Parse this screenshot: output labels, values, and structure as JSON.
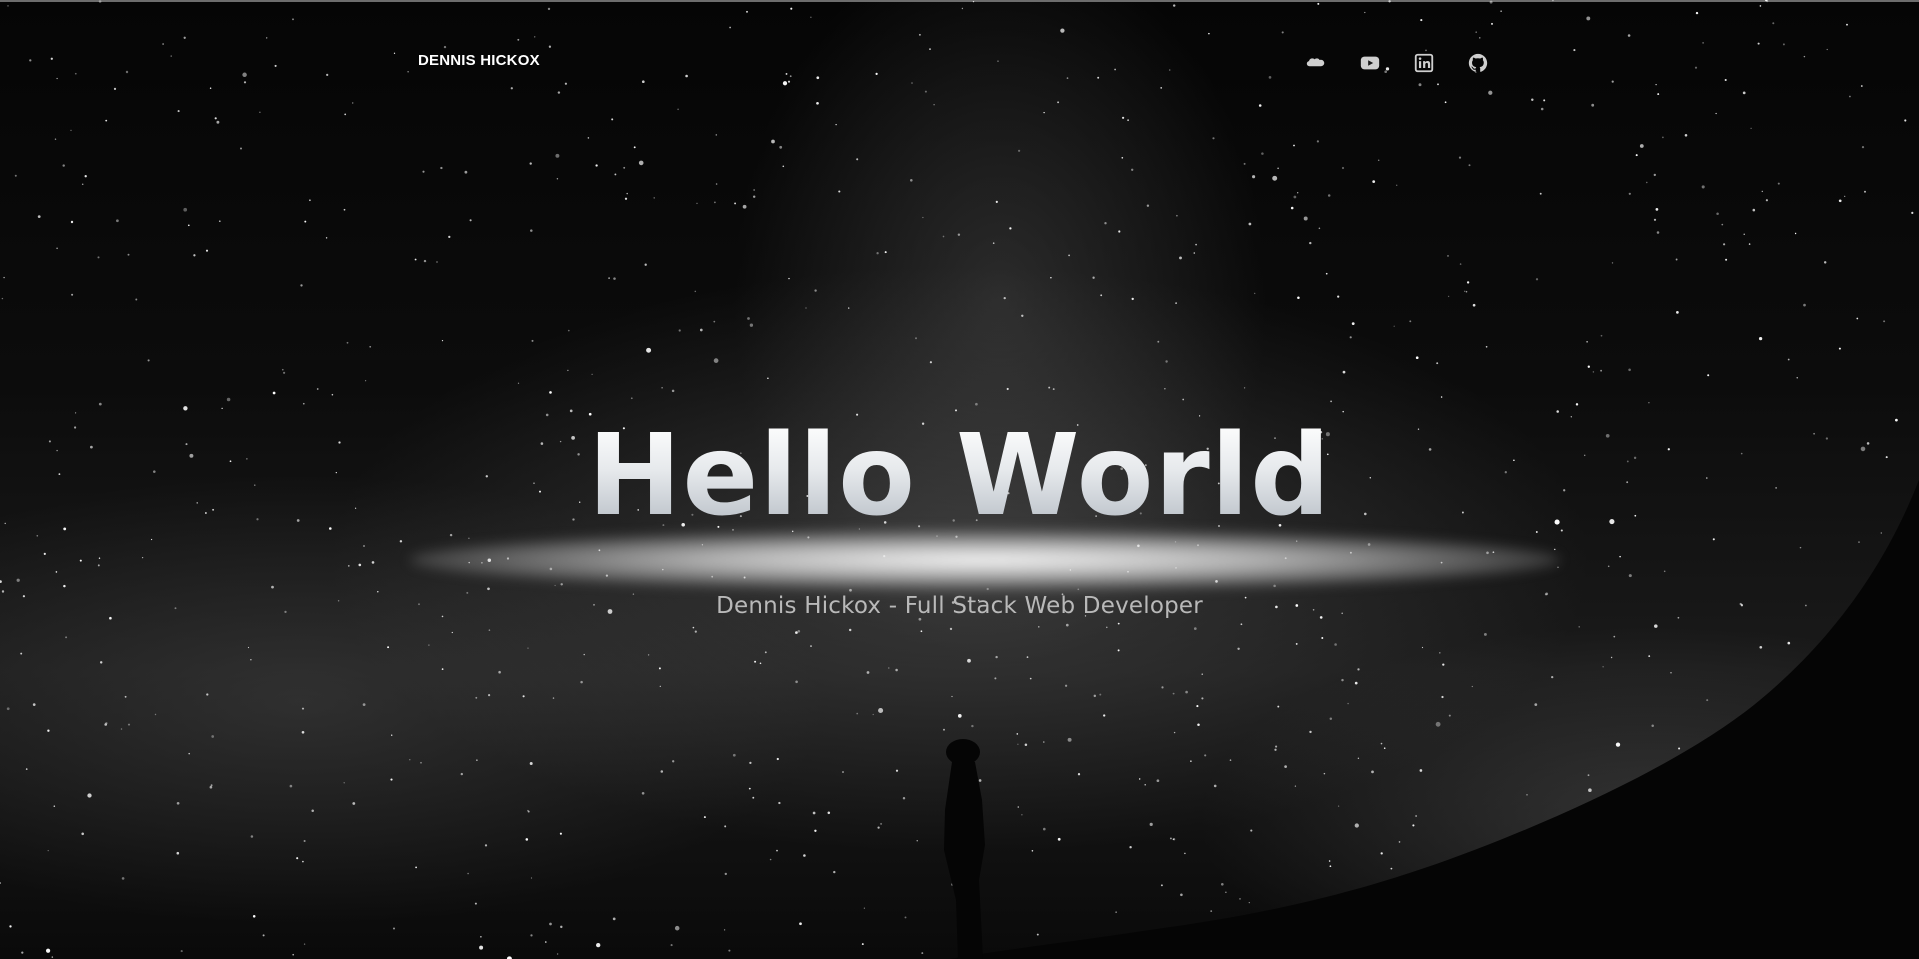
{
  "header": {
    "brand": "DENNIS HICKOX",
    "social_links": [
      {
        "icon": "salesforce-icon"
      },
      {
        "icon": "youtube-icon"
      },
      {
        "icon": "linkedin-icon"
      },
      {
        "icon": "github-icon"
      }
    ]
  },
  "hero": {
    "title": "Hello World",
    "subtitle": "Dennis Hickox - Full Stack Web Developer"
  },
  "colors": {
    "background": "#000000",
    "text": "#ffffff",
    "subtitle": "#b9b9b9"
  }
}
